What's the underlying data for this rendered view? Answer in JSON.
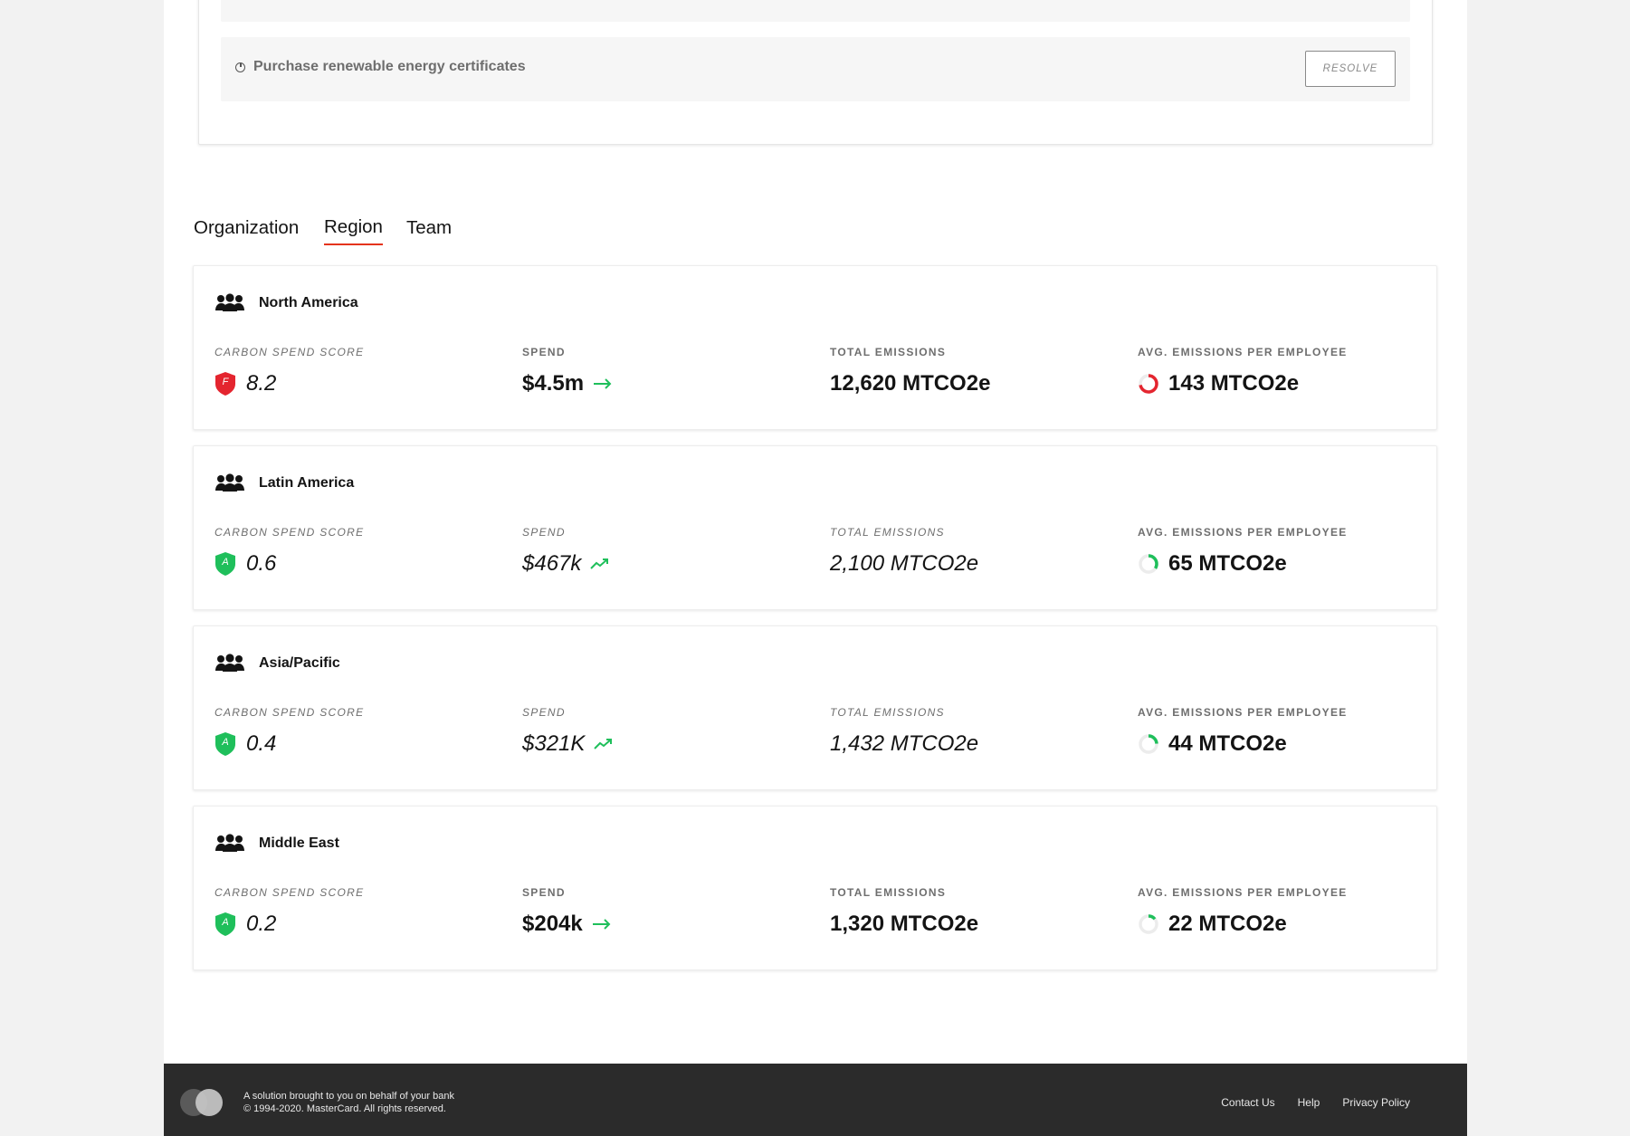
{
  "recommendations": {
    "items": [
      {
        "text": "",
        "resolve_label": ""
      },
      {
        "text": "Purchase renewable energy certificates",
        "resolve_label": "RESOLVE"
      }
    ]
  },
  "tabs": [
    {
      "label": "Organization",
      "active": false
    },
    {
      "label": "Region",
      "active": true
    },
    {
      "label": "Team",
      "active": false
    }
  ],
  "regions": [
    {
      "name": "North America",
      "score": {
        "label": "CARBON SPEND SCORE",
        "grade": "F",
        "value": "8.2",
        "color": "#e4252f"
      },
      "spend": {
        "label": "SPEND",
        "value": "$4.5m",
        "trend": "flat"
      },
      "total_emissions": {
        "label": "TOTAL EMISSIONS",
        "value": "12,620 MTCO2e"
      },
      "avg_emissions": {
        "label": "AVG. EMISSIONS PER EMPLOYEE",
        "value": "143 MTCO2e",
        "ring_color": "#e4252f",
        "ring_fraction": 0.72
      }
    },
    {
      "name": "Latin America",
      "score": {
        "label": "CARBON SPEND SCORE",
        "grade": "A",
        "value": "0.6",
        "color": "#1fbf5b"
      },
      "spend": {
        "label": "SPEND",
        "value": "$467k",
        "trend": "up"
      },
      "total_emissions": {
        "label": "TOTAL EMISSIONS",
        "value": "2,100 MTCO2e"
      },
      "avg_emissions": {
        "label": "AVG. EMISSIONS PER EMPLOYEE",
        "value": "65 MTCO2e",
        "ring_color": "#1fbf5b",
        "ring_fraction": 0.34
      }
    },
    {
      "name": "Asia/Pacific",
      "score": {
        "label": "CARBON SPEND SCORE",
        "grade": "A",
        "value": "0.4",
        "color": "#1fbf5b"
      },
      "spend": {
        "label": "SPEND",
        "value": "$321K",
        "trend": "up"
      },
      "total_emissions": {
        "label": "TOTAL EMISSIONS",
        "value": "1,432 MTCO2e"
      },
      "avg_emissions": {
        "label": "AVG. EMISSIONS PER EMPLOYEE",
        "value": "44 MTCO2e",
        "ring_color": "#1fbf5b",
        "ring_fraction": 0.24
      }
    },
    {
      "name": "Middle East",
      "score": {
        "label": "CARBON SPEND SCORE",
        "grade": "A",
        "value": "0.2",
        "color": "#1fbf5b"
      },
      "spend": {
        "label": "SPEND",
        "value": "$204k",
        "trend": "flat"
      },
      "total_emissions": {
        "label": "TOTAL EMISSIONS",
        "value": "1,320 MTCO2e"
      },
      "avg_emissions": {
        "label": "AVG. EMISSIONS PER EMPLOYEE",
        "value": "22 MTCO2e",
        "ring_color": "#1fbf5b",
        "ring_fraction": 0.14
      }
    }
  ],
  "footer": {
    "line1": "A solution brought to you on behalf of your bank",
    "line2": "© 1994-2020. MasterCard. All rights reserved.",
    "links": [
      "Contact Us",
      "Help",
      "Privacy Policy"
    ]
  },
  "colors": {
    "accent": "#e4331c",
    "trend_green": "#1fbf5b",
    "footer_bg": "#2b2b2b"
  }
}
